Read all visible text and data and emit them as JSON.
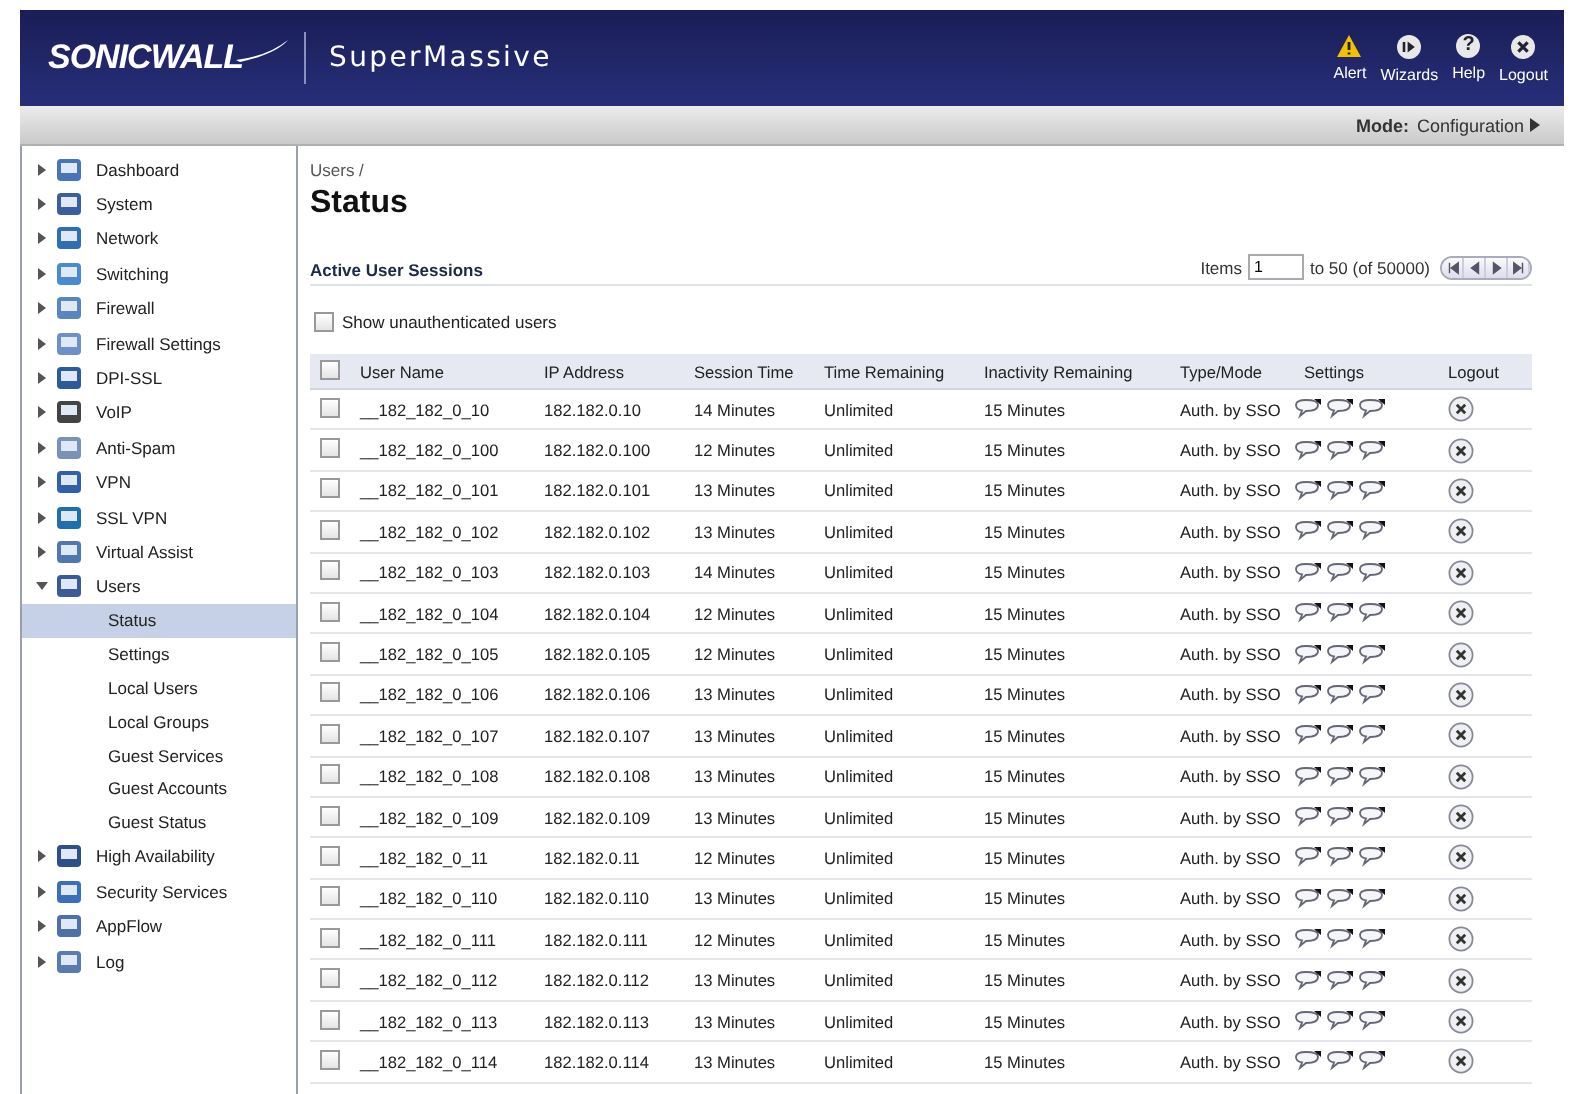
{
  "header": {
    "brand": "SONICWALL",
    "product": "SuperMassive",
    "actions": [
      {
        "kind": "alert",
        "label": "Alert"
      },
      {
        "kind": "wizard",
        "label": "Wizards"
      },
      {
        "kind": "help",
        "label": "Help",
        "glyph": "?"
      },
      {
        "kind": "logout",
        "label": "Logout"
      }
    ]
  },
  "mode_bar": {
    "label": "Mode:",
    "value": "Configuration"
  },
  "sidebar": {
    "items": [
      {
        "label": "Dashboard",
        "expanded": false
      },
      {
        "label": "System",
        "expanded": false
      },
      {
        "label": "Network",
        "expanded": false
      },
      {
        "label": "Switching",
        "expanded": false
      },
      {
        "label": "Firewall",
        "expanded": false
      },
      {
        "label": "Firewall Settings",
        "expanded": false
      },
      {
        "label": "DPI-SSL",
        "expanded": false
      },
      {
        "label": "VoIP",
        "expanded": false
      },
      {
        "label": "Anti-Spam",
        "expanded": false
      },
      {
        "label": "VPN",
        "expanded": false
      },
      {
        "label": "SSL VPN",
        "expanded": false
      },
      {
        "label": "Virtual Assist",
        "expanded": false
      },
      {
        "label": "Users",
        "expanded": true,
        "children": [
          {
            "label": "Status",
            "selected": true
          },
          {
            "label": "Settings",
            "selected": false
          },
          {
            "label": "Local Users",
            "selected": false
          },
          {
            "label": "Local Groups",
            "selected": false
          },
          {
            "label": "Guest Services",
            "selected": false
          },
          {
            "label": "Guest Accounts",
            "selected": false
          },
          {
            "label": "Guest Status",
            "selected": false
          }
        ]
      },
      {
        "label": "High Availability",
        "expanded": false
      },
      {
        "label": "Security Services",
        "expanded": false
      },
      {
        "label": "AppFlow",
        "expanded": false
      },
      {
        "label": "Log",
        "expanded": false
      }
    ]
  },
  "breadcrumb": "Users /",
  "page_title": "Status",
  "section_title": "Active User Sessions",
  "pager": {
    "label": "Items",
    "value": "1",
    "range": "to 50 (of 50000)"
  },
  "show_unauthenticated": {
    "label": "Show unauthenticated users",
    "checked": false
  },
  "table": {
    "select_all_checked": false,
    "columns": [
      "User Name",
      "IP Address",
      "Session Time",
      "Time Remaining",
      "Inactivity Remaining",
      "Type/Mode",
      "Settings",
      "Logout"
    ],
    "rows": [
      {
        "checked": false,
        "user": "__182_182_0_10",
        "ip": "182.182.0.10",
        "session": "14 Minutes",
        "remaining": "Unlimited",
        "inactivity": "15 Minutes",
        "type": "Auth. by SSO"
      },
      {
        "checked": false,
        "user": "__182_182_0_100",
        "ip": "182.182.0.100",
        "session": "12 Minutes",
        "remaining": "Unlimited",
        "inactivity": "15 Minutes",
        "type": "Auth. by SSO"
      },
      {
        "checked": false,
        "user": "__182_182_0_101",
        "ip": "182.182.0.101",
        "session": "13 Minutes",
        "remaining": "Unlimited",
        "inactivity": "15 Minutes",
        "type": "Auth. by SSO"
      },
      {
        "checked": false,
        "user": "__182_182_0_102",
        "ip": "182.182.0.102",
        "session": "13 Minutes",
        "remaining": "Unlimited",
        "inactivity": "15 Minutes",
        "type": "Auth. by SSO"
      },
      {
        "checked": false,
        "user": "__182_182_0_103",
        "ip": "182.182.0.103",
        "session": "14 Minutes",
        "remaining": "Unlimited",
        "inactivity": "15 Minutes",
        "type": "Auth. by SSO"
      },
      {
        "checked": false,
        "user": "__182_182_0_104",
        "ip": "182.182.0.104",
        "session": "12 Minutes",
        "remaining": "Unlimited",
        "inactivity": "15 Minutes",
        "type": "Auth. by SSO"
      },
      {
        "checked": false,
        "user": "__182_182_0_105",
        "ip": "182.182.0.105",
        "session": "12 Minutes",
        "remaining": "Unlimited",
        "inactivity": "15 Minutes",
        "type": "Auth. by SSO"
      },
      {
        "checked": false,
        "user": "__182_182_0_106",
        "ip": "182.182.0.106",
        "session": "13 Minutes",
        "remaining": "Unlimited",
        "inactivity": "15 Minutes",
        "type": "Auth. by SSO"
      },
      {
        "checked": false,
        "user": "__182_182_0_107",
        "ip": "182.182.0.107",
        "session": "13 Minutes",
        "remaining": "Unlimited",
        "inactivity": "15 Minutes",
        "type": "Auth. by SSO"
      },
      {
        "checked": false,
        "user": "__182_182_0_108",
        "ip": "182.182.0.108",
        "session": "13 Minutes",
        "remaining": "Unlimited",
        "inactivity": "15 Minutes",
        "type": "Auth. by SSO"
      },
      {
        "checked": false,
        "user": "__182_182_0_109",
        "ip": "182.182.0.109",
        "session": "13 Minutes",
        "remaining": "Unlimited",
        "inactivity": "15 Minutes",
        "type": "Auth. by SSO"
      },
      {
        "checked": false,
        "user": "__182_182_0_11",
        "ip": "182.182.0.11",
        "session": "12 Minutes",
        "remaining": "Unlimited",
        "inactivity": "15 Minutes",
        "type": "Auth. by SSO"
      },
      {
        "checked": false,
        "user": "__182_182_0_110",
        "ip": "182.182.0.110",
        "session": "13 Minutes",
        "remaining": "Unlimited",
        "inactivity": "15 Minutes",
        "type": "Auth. by SSO"
      },
      {
        "checked": false,
        "user": "__182_182_0_111",
        "ip": "182.182.0.111",
        "session": "12 Minutes",
        "remaining": "Unlimited",
        "inactivity": "15 Minutes",
        "type": "Auth. by SSO"
      },
      {
        "checked": false,
        "user": "__182_182_0_112",
        "ip": "182.182.0.112",
        "session": "13 Minutes",
        "remaining": "Unlimited",
        "inactivity": "15 Minutes",
        "type": "Auth. by SSO"
      },
      {
        "checked": false,
        "user": "__182_182_0_113",
        "ip": "182.182.0.113",
        "session": "13 Minutes",
        "remaining": "Unlimited",
        "inactivity": "15 Minutes",
        "type": "Auth. by SSO"
      },
      {
        "checked": false,
        "user": "__182_182_0_114",
        "ip": "182.182.0.114",
        "session": "13 Minutes",
        "remaining": "Unlimited",
        "inactivity": "15 Minutes",
        "type": "Auth. by SSO"
      }
    ]
  }
}
